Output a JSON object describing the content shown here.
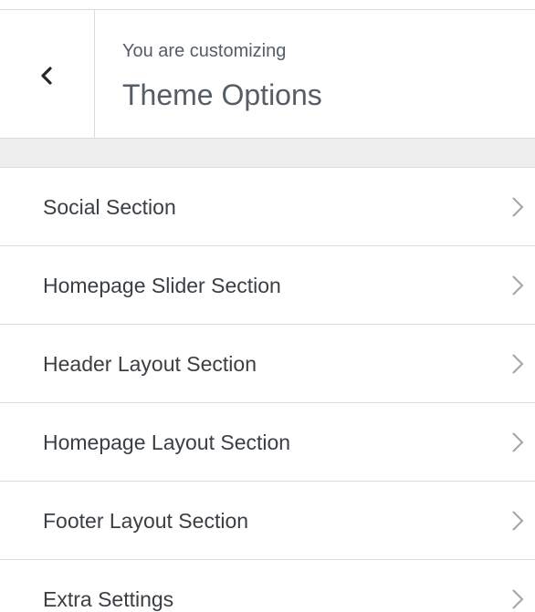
{
  "header": {
    "back_label": "Back",
    "preamble": "You are customizing",
    "title": "Theme Options"
  },
  "sections": [
    {
      "label": "Social Section"
    },
    {
      "label": "Homepage Slider Section"
    },
    {
      "label": "Header Layout Section"
    },
    {
      "label": "Homepage Layout Section"
    },
    {
      "label": "Footer Layout Section"
    },
    {
      "label": "Extra Settings"
    }
  ],
  "colors": {
    "text": "#3a3f44",
    "muted_text": "#555d66",
    "border": "#dcdcde",
    "spacer_bg": "#eeeeee",
    "chevron": "#a0a5aa"
  }
}
